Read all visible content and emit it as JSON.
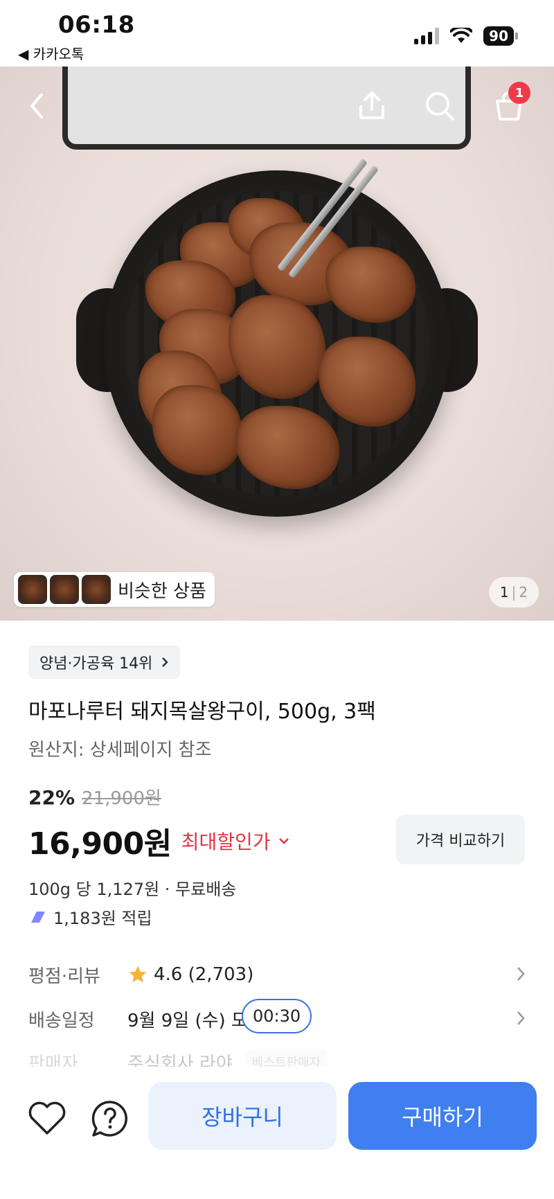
{
  "status_bar": {
    "time": "06:18",
    "back_app": "◀ 카카오톡",
    "battery": "90"
  },
  "header": {
    "cart_badge": "1",
    "icons": [
      "back-arrow-icon",
      "share-icon",
      "search-icon",
      "cart-icon"
    ]
  },
  "gallery": {
    "similar_label": "비슷한 상품",
    "current_page": "1",
    "separator": "|",
    "total_pages": "2"
  },
  "product": {
    "rank_chip": "양념·가공육 14위",
    "title": "마포나루터 돼지목살왕구이, 500g, 3팩",
    "origin": "원산지: 상세페이지 참조",
    "discount": "22%",
    "original_price": "21,900원",
    "price": "16,900원",
    "best_price_label": "최대할인가",
    "compare_button": "가격 비교하기",
    "unit_price": "100g 당 1,127원 · 무료배송",
    "points": "1,183원 적립"
  },
  "info": {
    "rating_label": "평점·리뷰",
    "rating_value": "4.6 (2,703)",
    "delivery_label": "배송일정",
    "delivery_value": "9월 9일 (수) 도",
    "delivery_time": "00:30",
    "seller_label": "판매자",
    "seller_value": "주식회사 라야",
    "seller_badge": "베스트판매자"
  },
  "bottom": {
    "cart_button": "장바구니",
    "buy_button": "구매하기"
  },
  "colors": {
    "accent_blue": "#3f7ff0",
    "discount_red": "#e4323f",
    "star": "#f5b335"
  }
}
